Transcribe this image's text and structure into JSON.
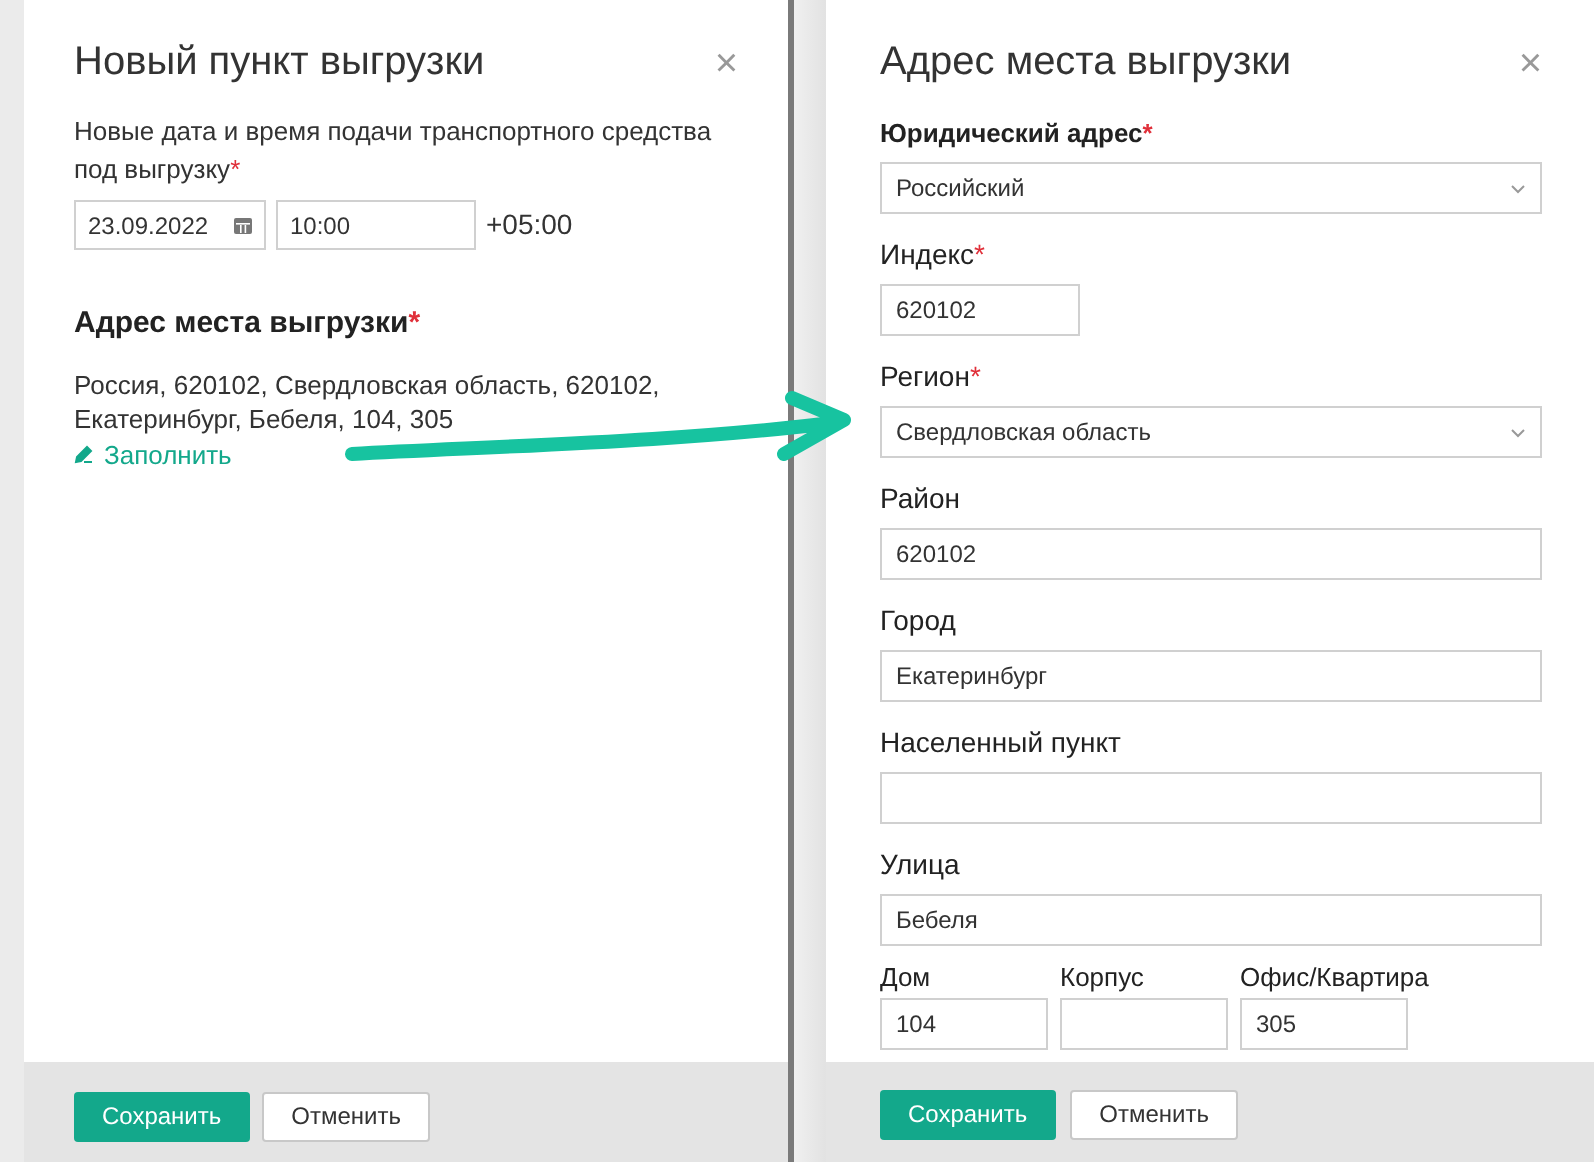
{
  "left": {
    "title": "Новый пункт выгрузки",
    "close": "×",
    "datetime_label": "Новые дата и время подачи транспортного средства под выгрузку",
    "required_mark": "*",
    "date": "23.09.2022",
    "time": "10:00",
    "timezone": "+05:00",
    "address_heading": "Адрес места выгрузки",
    "address_text": "Россия, 620102, Свердловская область, 620102, Екатеринбург, Бебеля, 104, 305",
    "fill_link": "Заполнить",
    "buttons": [
      {
        "label": "Сохранить",
        "kind": "primary"
      },
      {
        "label": "Отменить",
        "kind": "secondary"
      }
    ]
  },
  "right": {
    "title": "Адрес места выгрузки",
    "close": "×",
    "fields": [
      {
        "kind": "heading",
        "label": "Юридический адрес",
        "required_mark": "*"
      },
      {
        "kind": "select",
        "value": "Российский"
      },
      {
        "kind": "short_input",
        "label": "Индекс",
        "required_mark": "*",
        "value": "620102"
      },
      {
        "kind": "select",
        "label": "Регион",
        "required_mark": "*",
        "value": "Свердловская область"
      },
      {
        "kind": "input",
        "label": "Район",
        "value": "620102"
      },
      {
        "kind": "input",
        "label": "Город",
        "value": "Екатеринбург"
      },
      {
        "kind": "input",
        "label": "Населенный пункт"
      },
      {
        "kind": "input",
        "label": "Улица",
        "value": "Бебеля"
      },
      {
        "kind": "row",
        "items": [
          {
            "label": "Дом",
            "value": "104"
          },
          {
            "label": "Корпус"
          },
          {
            "label": "Офис/Квартира",
            "value": "305"
          }
        ]
      }
    ],
    "buttons": [
      {
        "label": "Сохранить",
        "kind": "primary"
      },
      {
        "label": "Отменить",
        "kind": "secondary"
      }
    ]
  }
}
